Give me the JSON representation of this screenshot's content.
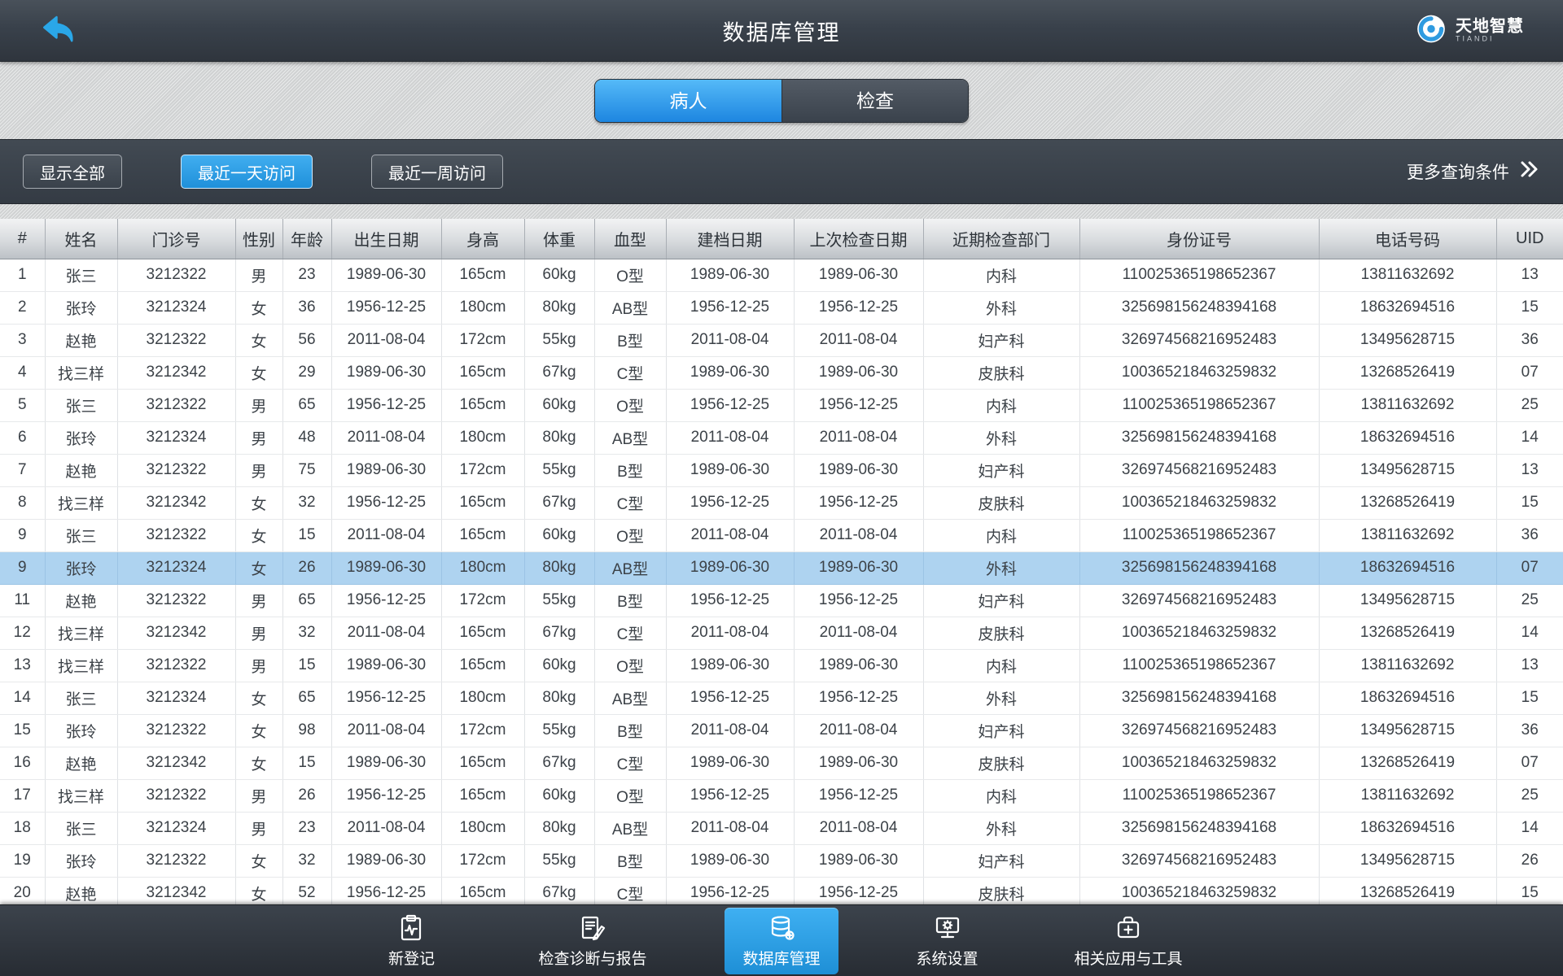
{
  "colors": {
    "accent_blue": "#2f9be0",
    "tab_active_blue": "#1d86e0",
    "selected_row_blue": "#aed3f0",
    "topbar_dark": "#39414b"
  },
  "topbar": {
    "title": "数据库管理",
    "back_icon": "back-arrow-icon",
    "logo_name": "天地智慧",
    "logo_sub": "TIANDI"
  },
  "tabs": [
    {
      "label": "病人",
      "active": true
    },
    {
      "label": "检查",
      "active": false
    }
  ],
  "filterbar": {
    "show_all": "显示全部",
    "last_day": "最近一天访问",
    "last_week": "最近一周访问",
    "more": "更多查询条件"
  },
  "table": {
    "columns": [
      "#",
      "姓名",
      "门诊号",
      "性别",
      "年龄",
      "出生日期",
      "身高",
      "体重",
      "血型",
      "建档日期",
      "上次检查日期",
      "近期检查部门",
      "身份证号",
      "电话号码",
      "UID"
    ],
    "selected_row_index": 9,
    "rows": [
      [
        "1",
        "张三",
        "3212322",
        "男",
        "23",
        "1989-06-30",
        "165cm",
        "60kg",
        "O型",
        "1989-06-30",
        "1989-06-30",
        "内科",
        "110025365198652367",
        "13811632692",
        "13"
      ],
      [
        "2",
        "张玲",
        "3212324",
        "女",
        "36",
        "1956-12-25",
        "180cm",
        "80kg",
        "AB型",
        "1956-12-25",
        "1956-12-25",
        "外科",
        "325698156248394168",
        "18632694516",
        "15"
      ],
      [
        "3",
        "赵艳",
        "3212322",
        "女",
        "56",
        "2011-08-04",
        "172cm",
        "55kg",
        "B型",
        "2011-08-04",
        "2011-08-04",
        "妇产科",
        "326974568216952483",
        "13495628715",
        "36"
      ],
      [
        "4",
        "找三样",
        "3212342",
        "女",
        "29",
        "1989-06-30",
        "165cm",
        "67kg",
        "C型",
        "1989-06-30",
        "1989-06-30",
        "皮肤科",
        "100365218463259832",
        "13268526419",
        "07"
      ],
      [
        "5",
        "张三",
        "3212322",
        "男",
        "65",
        "1956-12-25",
        "165cm",
        "60kg",
        "O型",
        "1956-12-25",
        "1956-12-25",
        "内科",
        "110025365198652367",
        "13811632692",
        "25"
      ],
      [
        "6",
        "张玲",
        "3212324",
        "男",
        "48",
        "2011-08-04",
        "180cm",
        "80kg",
        "AB型",
        "2011-08-04",
        "2011-08-04",
        "外科",
        "325698156248394168",
        "18632694516",
        "14"
      ],
      [
        "7",
        "赵艳",
        "3212322",
        "男",
        "75",
        "1989-06-30",
        "172cm",
        "55kg",
        "B型",
        "1989-06-30",
        "1989-06-30",
        "妇产科",
        "326974568216952483",
        "13495628715",
        "13"
      ],
      [
        "8",
        "找三样",
        "3212342",
        "女",
        "32",
        "1956-12-25",
        "165cm",
        "67kg",
        "C型",
        "1956-12-25",
        "1956-12-25",
        "皮肤科",
        "100365218463259832",
        "13268526419",
        "15"
      ],
      [
        "9",
        "张三",
        "3212322",
        "女",
        "15",
        "2011-08-04",
        "165cm",
        "60kg",
        "O型",
        "2011-08-04",
        "2011-08-04",
        "内科",
        "110025365198652367",
        "13811632692",
        "36"
      ],
      [
        "9",
        "张玲",
        "3212324",
        "女",
        "26",
        "1989-06-30",
        "180cm",
        "80kg",
        "AB型",
        "1989-06-30",
        "1989-06-30",
        "外科",
        "325698156248394168",
        "18632694516",
        "07"
      ],
      [
        "11",
        "赵艳",
        "3212322",
        "男",
        "65",
        "1956-12-25",
        "172cm",
        "55kg",
        "B型",
        "1956-12-25",
        "1956-12-25",
        "妇产科",
        "326974568216952483",
        "13495628715",
        "25"
      ],
      [
        "12",
        "找三样",
        "3212342",
        "男",
        "32",
        "2011-08-04",
        "165cm",
        "67kg",
        "C型",
        "2011-08-04",
        "2011-08-04",
        "皮肤科",
        "100365218463259832",
        "13268526419",
        "14"
      ],
      [
        "13",
        "找三样",
        "3212322",
        "男",
        "15",
        "1989-06-30",
        "165cm",
        "60kg",
        "O型",
        "1989-06-30",
        "1989-06-30",
        "内科",
        "110025365198652367",
        "13811632692",
        "13"
      ],
      [
        "14",
        "张三",
        "3212324",
        "女",
        "65",
        "1956-12-25",
        "180cm",
        "80kg",
        "AB型",
        "1956-12-25",
        "1956-12-25",
        "外科",
        "325698156248394168",
        "18632694516",
        "15"
      ],
      [
        "15",
        "张玲",
        "3212322",
        "女",
        "98",
        "2011-08-04",
        "172cm",
        "55kg",
        "B型",
        "2011-08-04",
        "2011-08-04",
        "妇产科",
        "326974568216952483",
        "13495628715",
        "36"
      ],
      [
        "16",
        "赵艳",
        "3212342",
        "女",
        "15",
        "1989-06-30",
        "165cm",
        "67kg",
        "C型",
        "1989-06-30",
        "1989-06-30",
        "皮肤科",
        "100365218463259832",
        "13268526419",
        "07"
      ],
      [
        "17",
        "找三样",
        "3212322",
        "男",
        "26",
        "1956-12-25",
        "165cm",
        "60kg",
        "O型",
        "1956-12-25",
        "1956-12-25",
        "内科",
        "110025365198652367",
        "13811632692",
        "25"
      ],
      [
        "18",
        "张三",
        "3212324",
        "男",
        "23",
        "2011-08-04",
        "180cm",
        "80kg",
        "AB型",
        "2011-08-04",
        "2011-08-04",
        "外科",
        "325698156248394168",
        "18632694516",
        "14"
      ],
      [
        "19",
        "张玲",
        "3212322",
        "女",
        "32",
        "1989-06-30",
        "172cm",
        "55kg",
        "B型",
        "1989-06-30",
        "1989-06-30",
        "妇产科",
        "326974568216952483",
        "13495628715",
        "26"
      ],
      [
        "20",
        "赵艳",
        "3212342",
        "女",
        "52",
        "1956-12-25",
        "165cm",
        "67kg",
        "C型",
        "1956-12-25",
        "1956-12-25",
        "皮肤科",
        "100365218463259832",
        "13268526419",
        "15"
      ]
    ]
  },
  "bottom_nav": {
    "items": [
      {
        "label": "新登记",
        "icon": "clipboard-ecg-icon",
        "active": false
      },
      {
        "label": "检查诊断与报告",
        "icon": "report-pen-icon",
        "active": false
      },
      {
        "label": "数据库管理",
        "icon": "database-icon",
        "active": true
      },
      {
        "label": "系统设置",
        "icon": "monitor-gear-icon",
        "active": false
      },
      {
        "label": "相关应用与工具",
        "icon": "toolbox-plus-icon",
        "active": false
      }
    ]
  }
}
